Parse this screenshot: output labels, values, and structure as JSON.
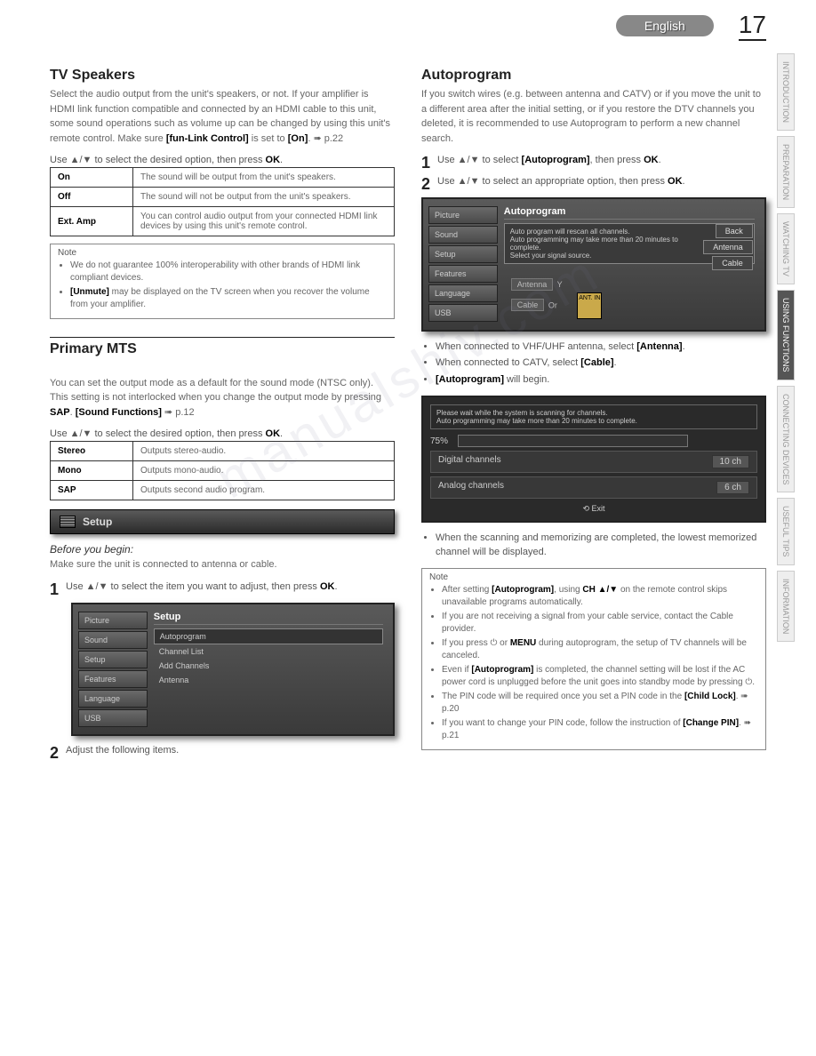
{
  "header": {
    "language": "English",
    "page_number": "17"
  },
  "side_tabs": [
    {
      "label": "INTRODUCTION",
      "active": false
    },
    {
      "label": "PREPARATION",
      "active": false
    },
    {
      "label": "WATCHING TV",
      "active": false
    },
    {
      "label": "USING FUNCTIONS",
      "active": true
    },
    {
      "label": "CONNECTING DEVICES",
      "active": false
    },
    {
      "label": "USEFUL TIPS",
      "active": false
    },
    {
      "label": "INFORMATION",
      "active": false
    }
  ],
  "left": {
    "tv_speakers": {
      "title": "TV Speakers",
      "para": "Select the audio output from the unit's speakers, or not. If your amplifier is HDMI link function compatible and connected by an HDMI cable to this unit, some sound operations such as volume up can be changed by using this unit's remote control. Make sure ",
      "para_bold1": "[fun-Link Control]",
      "para_mid": " is set to ",
      "para_bold2": "[On]",
      "para_ref": ". ➠ p.22",
      "instruct": "Use ▲/▼ to select the desired option, then press ",
      "instruct_bold": "OK",
      "rows": [
        {
          "k": "On",
          "v": "The sound will be output from the unit's speakers."
        },
        {
          "k": "Off",
          "v": "The sound will not be output from the unit's speakers."
        },
        {
          "k": "Ext. Amp",
          "v": "You can control audio output from your connected HDMI link devices by using this unit's remote control."
        }
      ],
      "note_title": "Note",
      "note1": "We do not guarantee 100% interoperability with other brands of HDMI link compliant devices.",
      "note2_bold": "[Unmute]",
      "note2_rest": " may be displayed on the TV screen when you recover the volume from your amplifier."
    },
    "primary_mts": {
      "title": "Primary MTS",
      "para": "You can set the output mode as a default for the sound mode (NTSC only).\nThis setting is not interlocked when you change the output mode by pressing ",
      "para_bold1": "SAP",
      "para_mid": ". ",
      "para_bold2": "[Sound Functions]",
      "para_ref": " ➠ p.12",
      "instruct": "Use ▲/▼ to select the desired option, then press ",
      "instruct_bold": "OK",
      "rows": [
        {
          "k": "Stereo",
          "v": "Outputs stereo-audio."
        },
        {
          "k": "Mono",
          "v": "Outputs mono-audio."
        },
        {
          "k": "SAP",
          "v": "Outputs second audio program."
        }
      ]
    },
    "setup_strip": "Setup",
    "before_begin": {
      "title": "Before you begin:",
      "text": "Make sure the unit is connected to antenna or cable."
    },
    "steps": {
      "s1_pre": "Use ▲/▼ to select the item you want to adjust, then press ",
      "s1_bold": "OK",
      "s1_post": ".",
      "s2": "Adjust the following items."
    },
    "osd_setup": {
      "sidebar": [
        "Picture",
        "Sound",
        "Setup",
        "Features",
        "Language",
        "USB"
      ],
      "main_title": "Setup",
      "items": [
        "Autoprogram",
        "Channel List",
        "Add Channels",
        "Antenna"
      ]
    }
  },
  "right": {
    "autoprogram": {
      "title": "Autoprogram",
      "para": "If you switch wires (e.g. between antenna and CATV) or if you move the unit to a different area after the initial setting, or if you restore the DTV channels you deleted, it is recommended to use Autoprogram to perform a new channel search.",
      "s1_pre": "Use ▲/▼ to select ",
      "s1_bold1": "[Autoprogram]",
      "s1_mid": ", then press ",
      "s1_bold2": "OK",
      "s2_pre": "Use ▲/▼ to select an appropriate option, then press ",
      "s2_bold": "OK"
    },
    "osd_autoprogram": {
      "sidebar": [
        "Picture",
        "Sound",
        "Setup",
        "Features",
        "Language",
        "USB"
      ],
      "main_title": "Autoprogram",
      "msg_l1": "Auto program will rescan all channels.",
      "msg_l2": "Auto programming may take more than 20 minutes to complete.",
      "msg_l3": "Select your signal source.",
      "options": [
        "Back",
        "Antenna",
        "Cable"
      ],
      "diag_ant": "Antenna",
      "diag_cable": "Cable",
      "diag_or": "Or",
      "diag_jack": "ANT. IN"
    },
    "bullets1": {
      "b1_pre": "When connected to VHF/UHF antenna, select ",
      "b1_bold": "[Antenna]",
      "b2_pre": "When connected to CATV, select ",
      "b2_bold": "[Cable]",
      "b3_bold": "[Autoprogram]",
      "b3_rest": " will begin."
    },
    "progress_osd": {
      "msg_l1": "Please wait while the system is scanning for channels.",
      "msg_l2": "Auto programming may take more than 20 minutes to complete.",
      "percent": "75%",
      "row1_label": "Digital channels",
      "row1_val": "10 ch",
      "row2_label": "Analog channels",
      "row2_val": "6 ch",
      "exit": "Exit"
    },
    "bullets2": {
      "b1": "When the scanning and memorizing are completed, the lowest memorized channel will be displayed."
    },
    "note": {
      "title": "Note",
      "n1_pre": "After setting ",
      "n1_bold1": "[Autoprogram]",
      "n1_mid": ", using ",
      "n1_bold2": "CH ▲/▼",
      "n1_post": " on the remote control skips unavailable programs automatically.",
      "n2": "If you are not receiving a signal from your cable service, contact the Cable provider.",
      "n3_pre": "If you press ⏻ or ",
      "n3_bold": "MENU",
      "n3_post": " during autoprogram, the setup of TV channels will be canceled.",
      "n4_pre": "Even if ",
      "n4_bold": "[Autoprogram]",
      "n4_post": " is completed, the channel setting will be lost if the AC power cord is unplugged before the unit goes into standby mode by pressing ⏻.",
      "n5_pre": "The PIN code will be required once you set a PIN code in the ",
      "n5_bold": "[Child Lock]",
      "n5_post": ". ➠ p.20",
      "n6_pre": "If you want to change your PIN code, follow the instruction of ",
      "n6_bold": "[Change PIN]",
      "n6_post": ". ➠ p.21"
    }
  },
  "watermark": "manualshiv.com"
}
